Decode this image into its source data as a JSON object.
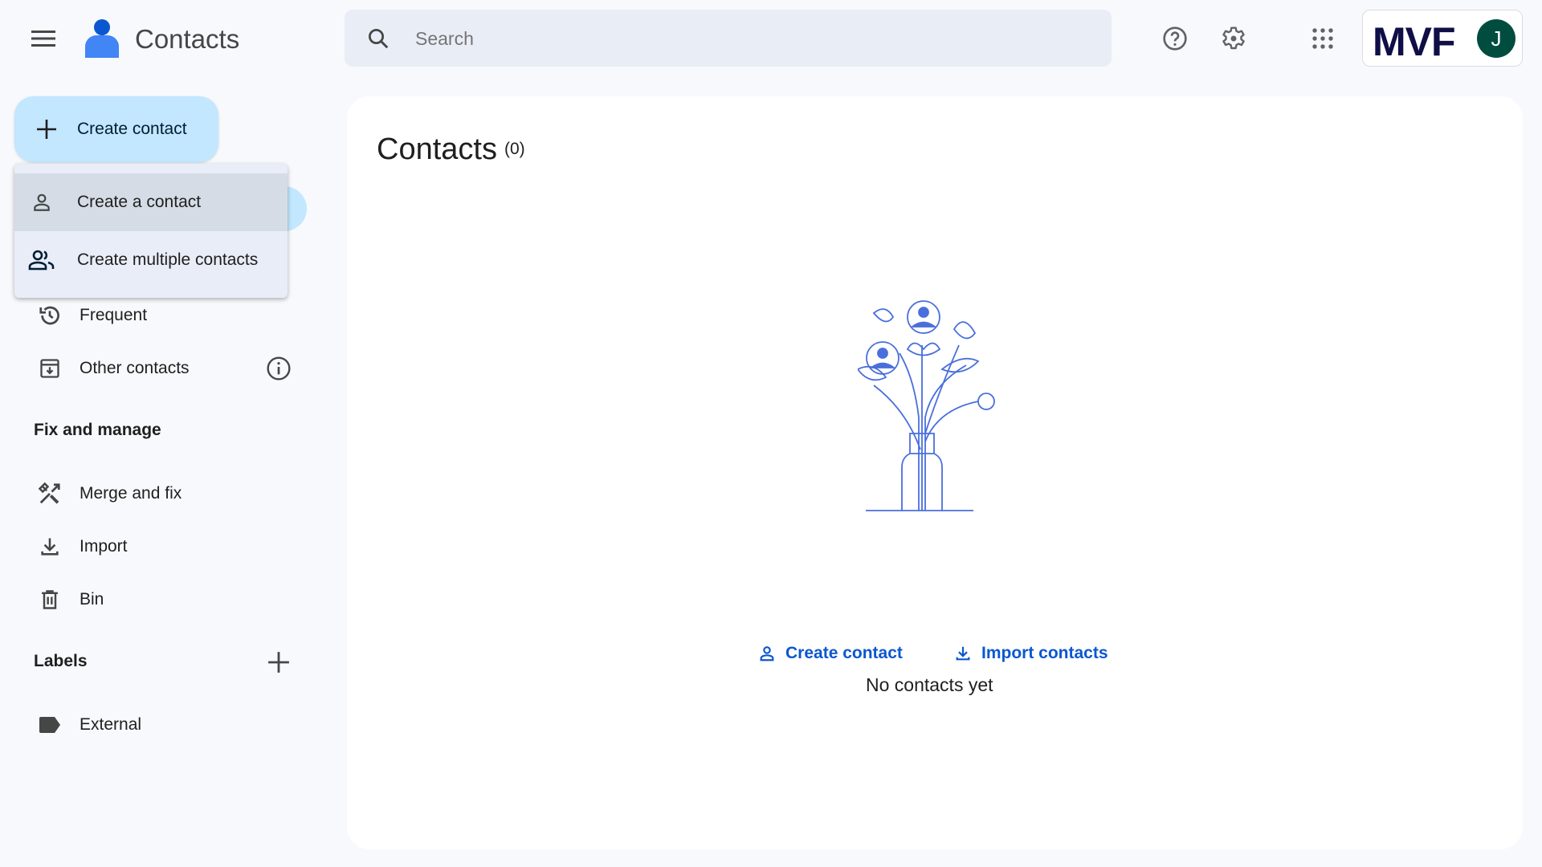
{
  "header": {
    "app_title": "Contacts",
    "search_placeholder": "Search",
    "org_logo": "MVF",
    "avatar_initial": "J",
    "icons": [
      "menu-icon",
      "contacts-logo-icon",
      "search-icon",
      "help-icon",
      "settings-icon",
      "apps-icon"
    ]
  },
  "sidebar": {
    "create_button": "Create contact",
    "create_menu": [
      {
        "label": "Create a contact",
        "icon": "person-icon"
      },
      {
        "label": "Create multiple contacts",
        "icon": "people-icon"
      }
    ],
    "items": [
      {
        "label": "Frequent",
        "icon": "history-icon"
      },
      {
        "label": "Other contacts",
        "icon": "archive-download-icon"
      }
    ],
    "fix_section": "Fix and manage",
    "fix_items": [
      {
        "label": "Merge and fix",
        "icon": "tools-icon"
      },
      {
        "label": "Import",
        "icon": "download-icon"
      },
      {
        "label": "Bin",
        "icon": "trash-icon"
      }
    ],
    "labels_section": "Labels",
    "labels": [
      {
        "label": "External",
        "icon": "label-icon"
      }
    ]
  },
  "main": {
    "title": "Contacts",
    "count": "(0)",
    "empty_text": "No contacts yet",
    "create_link": "Create contact",
    "import_link": "Import contacts"
  },
  "colors": {
    "accent": "#0b57d0",
    "create_button": "#c2e7ff",
    "avatar": "#004d40",
    "logo": "#0f0e47"
  }
}
